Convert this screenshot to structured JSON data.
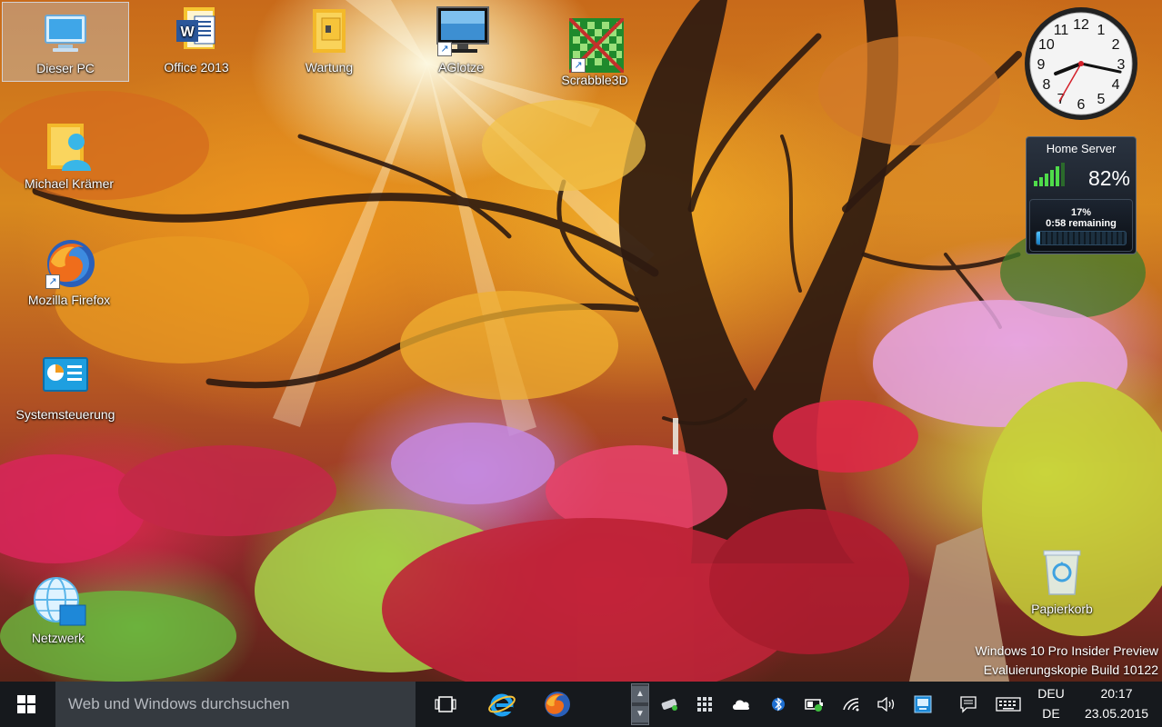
{
  "desktop": {
    "icons": [
      {
        "label": "Dieser PC",
        "icon": "computer-icon"
      },
      {
        "label": "Office 2013",
        "icon": "word-icon"
      },
      {
        "label": "Wartung",
        "icon": "folder-icon"
      },
      {
        "label": "AGlotze",
        "icon": "monitor-icon"
      },
      {
        "label": "Scrabble3D",
        "icon": "scrabble-board-icon"
      },
      {
        "label": "Michael Krämer",
        "icon": "user-folder-icon"
      },
      {
        "label": "Mozilla Firefox",
        "icon": "firefox-icon"
      },
      {
        "label": "Systemsteuerung",
        "icon": "control-panel-icon"
      },
      {
        "label": "Netzwerk",
        "icon": "network-globe-icon"
      },
      {
        "label": "Papierkorb",
        "icon": "recycle-bin-icon"
      }
    ]
  },
  "gadgets": {
    "clock": {
      "numerals": [
        "12",
        "1",
        "2",
        "3",
        "4",
        "5",
        "6",
        "7",
        "8",
        "9",
        "10",
        "11"
      ],
      "hour": 8,
      "minute": 17,
      "second": 35
    },
    "server": {
      "title": "Home Server",
      "signal_percent": "82%",
      "progress_label": "17%",
      "remaining_label": "0:58 remaining",
      "progress_fraction": 0.04
    }
  },
  "watermark": {
    "line1": "Windows 10 Pro Insider Preview",
    "line2": "Evaluierungskopie Build 10122"
  },
  "taskbar": {
    "search_placeholder": "Web und Windows durchsuchen",
    "language_line1": "DEU",
    "language_line2": "DE",
    "time": "20:17",
    "date": "23.05.2015",
    "tray_icons": [
      "usb-drive-icon",
      "keyboard-grid-icon",
      "cloud-icon",
      "bluetooth-icon",
      "battery-icon",
      "wifi-icon",
      "volume-icon",
      "monitor-app-icon",
      "action-center-icon",
      "touch-keyboard-icon"
    ]
  }
}
